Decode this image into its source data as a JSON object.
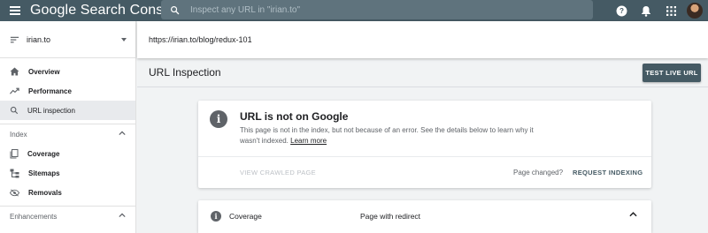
{
  "header": {
    "brand": "Google Search Console",
    "search_placeholder": "Inspect any URL in \"irian.to\"",
    "icons": [
      "menu-icon",
      "search-icon",
      "help-icon",
      "notifications-icon",
      "apps-icon",
      "avatar"
    ]
  },
  "sidebar": {
    "property": "irian.to",
    "items": [
      {
        "label": "Overview",
        "icon": "home-icon"
      },
      {
        "label": "Performance",
        "icon": "trending-icon"
      },
      {
        "label": "URL inspection",
        "icon": "search-icon",
        "active": true
      }
    ],
    "sections": [
      {
        "title": "Index",
        "items": [
          {
            "label": "Coverage",
            "icon": "coverage-icon"
          },
          {
            "label": "Sitemaps",
            "icon": "sitemap-icon"
          },
          {
            "label": "Removals",
            "icon": "removals-icon"
          }
        ]
      },
      {
        "title": "Enhancements",
        "items": []
      }
    ]
  },
  "url_bar": {
    "url": "https://irian.to/blog/redux-101"
  },
  "page": {
    "title": "URL Inspection",
    "test_live_label": "TEST LIVE URL"
  },
  "status_card": {
    "title": "URL is not on Google",
    "description": "This page is not in the index, but not because of an error. See the details below to learn why it wasn't indexed.",
    "learn_more": "Learn more",
    "view_crawled": "VIEW CRAWLED PAGE",
    "page_changed": "Page changed?",
    "request_indexing": "REQUEST INDEXING"
  },
  "coverage": {
    "label": "Coverage",
    "value": "Page with redirect"
  },
  "colors": {
    "topbar": "#455a64",
    "accent": "#455a64",
    "background": "#f1f3f4"
  }
}
